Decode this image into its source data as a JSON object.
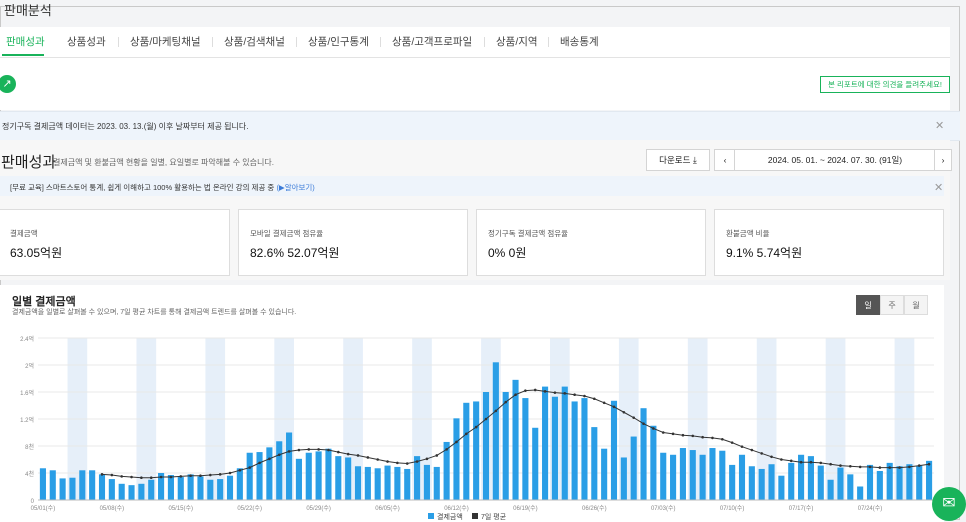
{
  "page_title": "판매분석",
  "tabs": [
    "판매성과",
    "상품성과",
    "상품/마케팅채널",
    "상품/검색채널",
    "상품/인구통계",
    "상품/고객프로파일",
    "상품/지역",
    "배송통계"
  ],
  "opinion_button": "본 리포트에 대한 의견을 들려주세요!",
  "notice_subscription": "정기구독 결제금액 데이터는 2023. 03. 13.(월) 이후 날짜부터 제공 됩니다.",
  "section": {
    "title": "판매성과",
    "description": "결제금액 및 환불금액 현황을 일별, 요일별로 파악해볼 수 있습니다.",
    "download_label": "다운로드",
    "date_range": "2024. 05. 01. ~ 2024. 07. 30. (91일)"
  },
  "education_notice": {
    "text": "[무료 교육] 스마트스토어 통계, 쉽게 이해하고 100% 활용하는 법 온라인 강의 제공 중",
    "link": "(▶알아보기)"
  },
  "metrics": [
    {
      "label": "결제금액",
      "value": "63.05억원"
    },
    {
      "label": "모바일 결제금액 점유율",
      "value": "82.6%  52.07억원"
    },
    {
      "label": "정기구독 결제금액 점유율",
      "value": "0%  0원"
    },
    {
      "label": "환불금액 비율",
      "value": "9.1%  5.74억원"
    }
  ],
  "chart_header": {
    "title": "일별 결제금액",
    "description": "결제금액을 일별로 살펴볼 수 있으며, 7일 평균 차트를 통해 결제금액 트렌드를 살펴볼 수 있습니다.",
    "period_buttons": [
      "일",
      "주",
      "월"
    ]
  },
  "colors": {
    "accent": "#19b35a",
    "bar": "#2a9ee6",
    "avg_line": "#333333",
    "weekend_band": "#e6eff9"
  },
  "chart_data": {
    "type": "bar",
    "ylim": [
      0,
      240000000
    ],
    "y_ticks": [
      0,
      40000000,
      80000000,
      120000000,
      160000000,
      200000000,
      240000000
    ],
    "y_tick_labels": [
      "0",
      "4천",
      "8천",
      "1.2억",
      "1.6억",
      "2억",
      "2.4억"
    ],
    "x_tick_labels": [
      "05/01(수)",
      "05/08(수)",
      "05/15(수)",
      "05/22(수)",
      "05/29(수)",
      "06/05(수)",
      "06/12(수)",
      "06/19(수)",
      "06/26(수)",
      "07/03(수)",
      "07/10(수)",
      "07/17(수)",
      "07/24(수)"
    ],
    "x_tick_index": [
      0,
      7,
      14,
      21,
      28,
      35,
      42,
      49,
      56,
      63,
      70,
      77,
      84
    ],
    "series": [
      {
        "name": "결제금액",
        "values": [
          47000000,
          44000000,
          32000000,
          33000000,
          44000000,
          44000000,
          38000000,
          31000000,
          24000000,
          22000000,
          24000000,
          30000000,
          40000000,
          37000000,
          34000000,
          38000000,
          35000000,
          30000000,
          31000000,
          36000000,
          47000000,
          70000000,
          71000000,
          78000000,
          87000000,
          100000000,
          61000000,
          70000000,
          72000000,
          76000000,
          65000000,
          63000000,
          50000000,
          49000000,
          47000000,
          51000000,
          49000000,
          46000000,
          65000000,
          52000000,
          49000000,
          86000000,
          121000000,
          144000000,
          146000000,
          160000000,
          204000000,
          160000000,
          178000000,
          151000000,
          107000000,
          168000000,
          153000000,
          168000000,
          146000000,
          151000000,
          108000000,
          76000000,
          147000000,
          63000000,
          94000000,
          136000000,
          110000000,
          70000000,
          67000000,
          77000000,
          74000000,
          67000000,
          77000000,
          73000000,
          52000000,
          67000000,
          50000000,
          46000000,
          53000000,
          36000000,
          55000000,
          67000000,
          65000000,
          51000000,
          30000000,
          48000000,
          38000000,
          20000000,
          52000000,
          43000000,
          55000000,
          50000000,
          53000000,
          51000000,
          58000000
        ]
      },
      {
        "name": "7일 평균",
        "values": [
          null,
          null,
          null,
          null,
          null,
          null,
          38000000,
          37000000,
          35000000,
          34000000,
          33000000,
          33000000,
          34000000,
          34000000,
          35000000,
          36000000,
          36000000,
          37000000,
          38000000,
          40000000,
          44000000,
          48000000,
          55000000,
          61000000,
          67000000,
          72000000,
          74000000,
          75000000,
          75000000,
          74000000,
          71000000,
          68000000,
          66000000,
          63000000,
          60000000,
          57000000,
          55000000,
          54000000,
          57000000,
          61000000,
          66000000,
          75000000,
          86000000,
          98000000,
          108000000,
          120000000,
          132000000,
          145000000,
          156000000,
          162000000,
          163000000,
          161000000,
          159000000,
          158000000,
          156000000,
          154000000,
          150000000,
          144000000,
          138000000,
          130000000,
          122000000,
          113000000,
          106000000,
          100000000,
          98000000,
          96000000,
          95000000,
          93000000,
          92000000,
          90000000,
          85000000,
          79000000,
          74000000,
          69000000,
          64000000,
          60000000,
          58000000,
          56000000,
          56000000,
          55000000,
          53000000,
          51000000,
          50000000,
          49000000,
          49000000,
          48000000,
          48000000,
          48000000,
          49000000,
          51000000,
          53000000
        ]
      }
    ],
    "legend": [
      "결제금액",
      "7일 평균"
    ]
  }
}
